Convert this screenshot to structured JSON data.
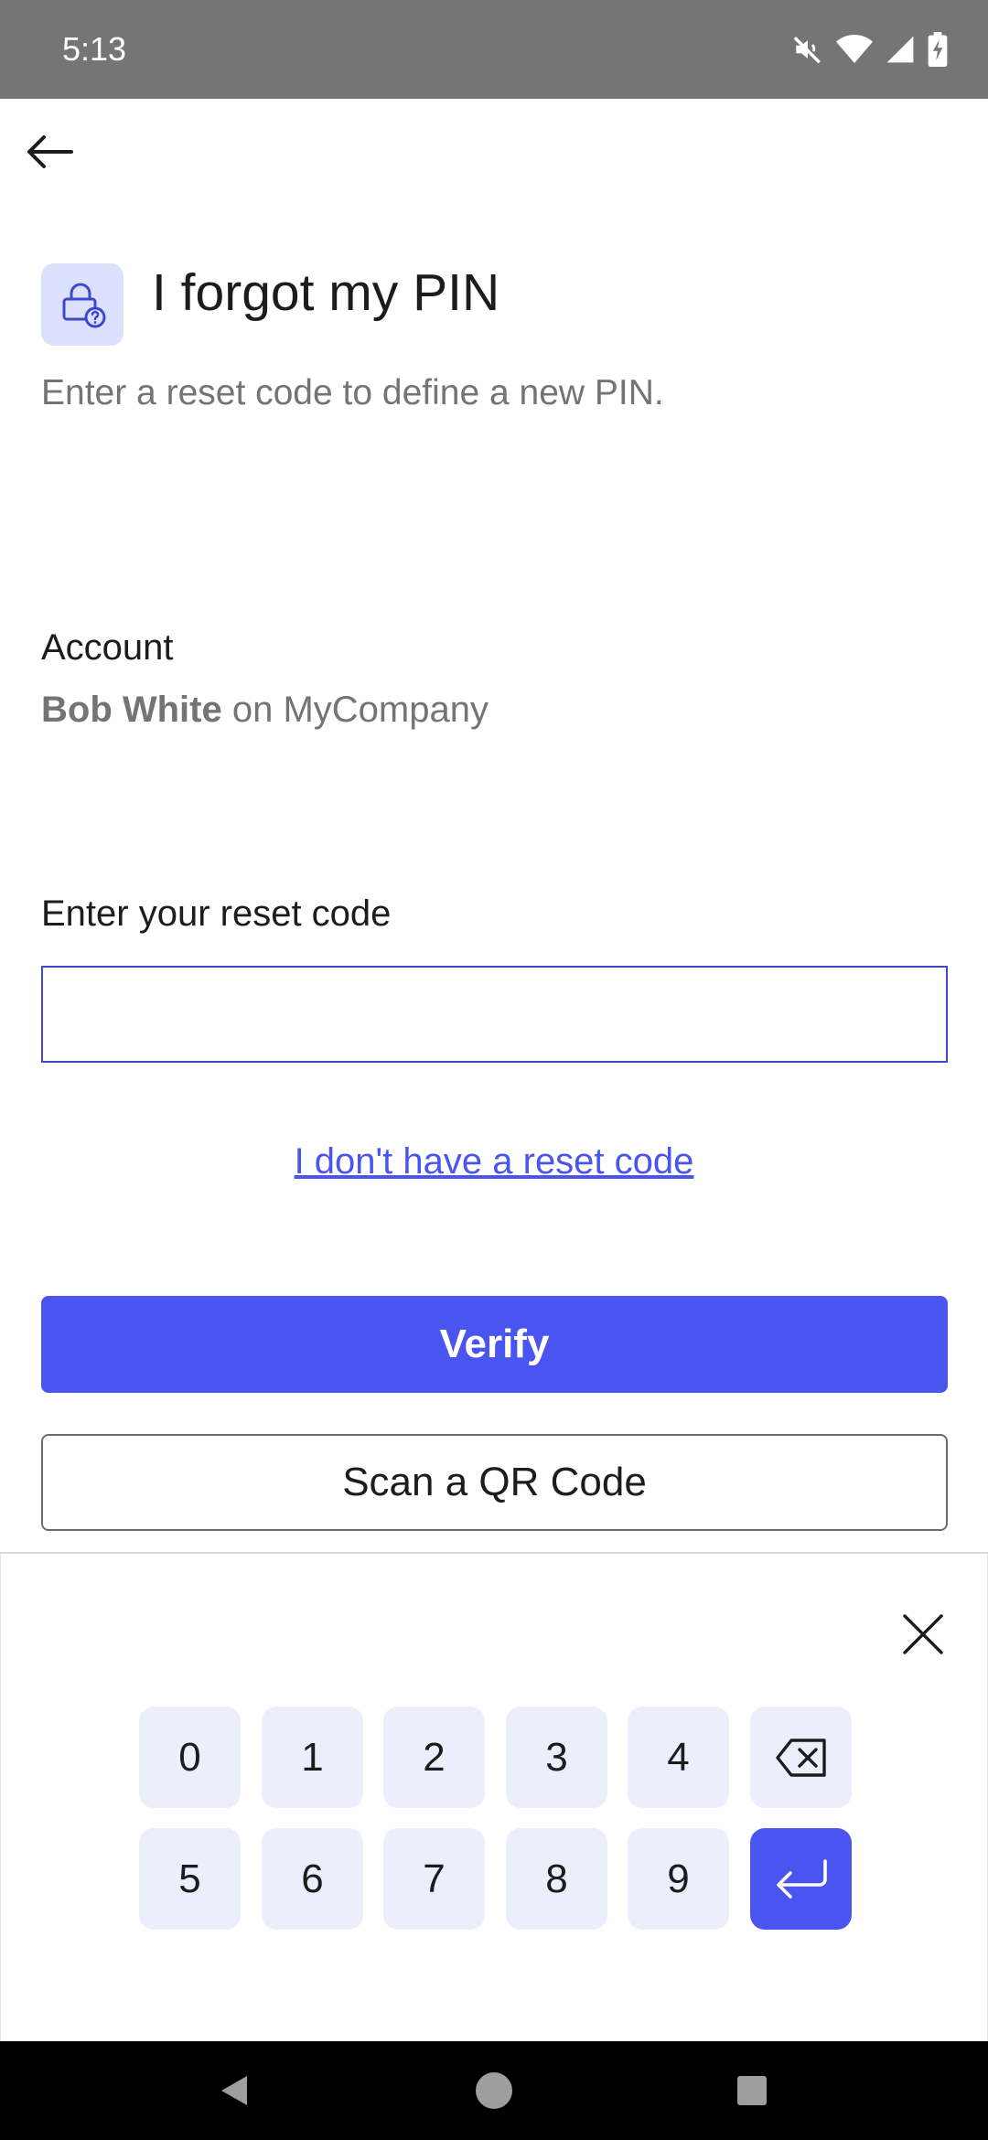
{
  "status_bar": {
    "time": "5:13",
    "icons": [
      "mute-icon",
      "wifi-icon",
      "signal-icon",
      "battery-charging-icon"
    ]
  },
  "header": {
    "back_icon": "arrow-left-icon",
    "icon": "lock-question-icon",
    "title": "I forgot my PIN",
    "subtitle": "Enter a reset code to define a new PIN."
  },
  "account": {
    "label": "Account",
    "name": "Bob White",
    "suffix": " on MyCompany"
  },
  "reset_code": {
    "label": "Enter your reset code",
    "value": "",
    "placeholder": "",
    "no_code_link": "I don't have a reset code"
  },
  "actions": {
    "verify_label": "Verify",
    "scan_label": "Scan a QR Code"
  },
  "keypad": {
    "close_icon": "close-icon",
    "row1": [
      "0",
      "1",
      "2",
      "3",
      "4"
    ],
    "row2": [
      "5",
      "6",
      "7",
      "8",
      "9"
    ],
    "backspace_icon": "backspace-icon",
    "enter_icon": "enter-icon"
  },
  "colors": {
    "accent": "#4a55f0",
    "link": "#4a55ee",
    "key_bg": "#eceefc",
    "icon_bg": "#dbe0fb",
    "status_bar": "#757575"
  },
  "nav_bar": {
    "icons": [
      "nav-back-icon",
      "nav-home-icon",
      "nav-recents-icon"
    ]
  }
}
